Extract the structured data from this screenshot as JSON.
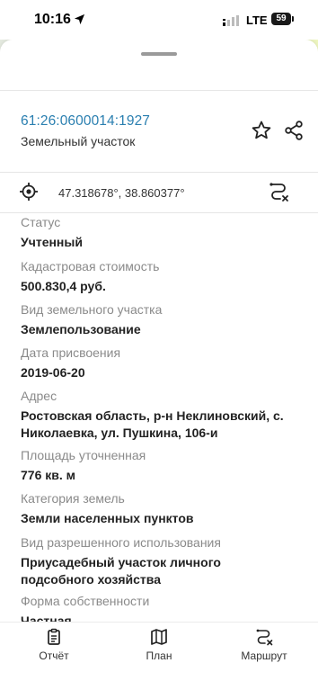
{
  "status_bar": {
    "time": "10:16",
    "network": "LTE",
    "battery": "59"
  },
  "parcel": {
    "cadastral_number": "61:26:0600014:1927",
    "type": "Земельный участок",
    "coordinates": "47.318678°, 38.860377°"
  },
  "fields": [
    {
      "label": "Статус",
      "value": "Учтенный"
    },
    {
      "label": "Кадастровая стоимость",
      "value": "500.830,4 руб."
    },
    {
      "label": "Вид земельного участка",
      "value": "Землепользование"
    },
    {
      "label": "Дата присвоения",
      "value": "2019-06-20"
    },
    {
      "label": "Адрес",
      "value_lines": [
        "Ростовская область, р-н Неклиновский, с.",
        "Николаевка, ул. Пушкина, 106-и"
      ]
    },
    {
      "label": "Площадь уточненная",
      "value": "776 кв. м"
    },
    {
      "label": "Категория земель",
      "value": "Земли населенных пунктов"
    },
    {
      "label": "Вид разрешенного использования",
      "value_lines": [
        "Приусадебный участок личного",
        "подсобного хозяйства"
      ]
    },
    {
      "label": "Форма собственности",
      "value": "Частная"
    }
  ],
  "bottom_nav": [
    {
      "label": "Отчёт",
      "icon": "report-icon"
    },
    {
      "label": "План",
      "icon": "map-icon"
    },
    {
      "label": "Маршрут",
      "icon": "route-icon"
    }
  ],
  "colors": {
    "accent": "#2a7fb0",
    "label_gray": "#8a8a8a"
  }
}
